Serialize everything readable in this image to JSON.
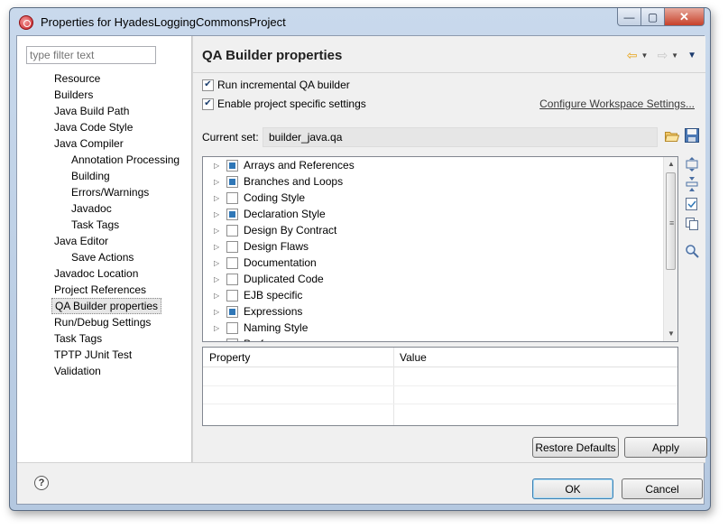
{
  "window": {
    "title": "Properties for HyadesLoggingCommonsProject"
  },
  "filter": {
    "placeholder": "type filter text"
  },
  "tree": {
    "items": [
      {
        "label": "Resource",
        "level": 1
      },
      {
        "label": "Builders",
        "level": 1
      },
      {
        "label": "Java Build Path",
        "level": 1
      },
      {
        "label": "Java Code Style",
        "level": 1
      },
      {
        "label": "Java Compiler",
        "level": 1
      },
      {
        "label": "Annotation Processing",
        "level": 2
      },
      {
        "label": "Building",
        "level": 2
      },
      {
        "label": "Errors/Warnings",
        "level": 2
      },
      {
        "label": "Javadoc",
        "level": 2
      },
      {
        "label": "Task Tags",
        "level": 2
      },
      {
        "label": "Java Editor",
        "level": 1
      },
      {
        "label": "Save Actions",
        "level": 2
      },
      {
        "label": "Javadoc Location",
        "level": 1
      },
      {
        "label": "Project References",
        "level": 1
      },
      {
        "label": "QA Builder properties",
        "level": 1,
        "selected": true
      },
      {
        "label": "Run/Debug Settings",
        "level": 1
      },
      {
        "label": "Task Tags",
        "level": 1
      },
      {
        "label": "TPTP JUnit Test",
        "level": 1
      },
      {
        "label": "Validation",
        "level": 1
      }
    ]
  },
  "page": {
    "title": "QA Builder properties",
    "run_incremental": {
      "label": "Run incremental QA builder",
      "checked": true
    },
    "enable_specific": {
      "label": "Enable project specific settings",
      "checked": true
    },
    "configure_link": "Configure Workspace Settings...",
    "current_set_label": "Current set:",
    "current_set_value": "builder_java.qa"
  },
  "rules": [
    {
      "label": "Arrays and References",
      "checked": true
    },
    {
      "label": "Branches and Loops",
      "checked": true
    },
    {
      "label": "Coding Style",
      "checked": false
    },
    {
      "label": "Declaration Style",
      "checked": true
    },
    {
      "label": "Design By Contract",
      "checked": false
    },
    {
      "label": "Design Flaws",
      "checked": false
    },
    {
      "label": "Documentation",
      "checked": false
    },
    {
      "label": "Duplicated Code",
      "checked": false
    },
    {
      "label": "EJB specific",
      "checked": false
    },
    {
      "label": "Expressions",
      "checked": true
    },
    {
      "label": "Naming Style",
      "checked": false
    },
    {
      "label": "Perf",
      "checked": false
    }
  ],
  "properties_table": {
    "columns": [
      "Property",
      "Value"
    ],
    "rows": []
  },
  "buttons": {
    "restore_defaults": "Restore Defaults",
    "apply": "Apply",
    "ok": "OK",
    "cancel": "Cancel"
  },
  "colors": {
    "checked_fill": "#2f77b7",
    "nav_back": "#e8a317"
  },
  "icons": {
    "help": "?"
  }
}
